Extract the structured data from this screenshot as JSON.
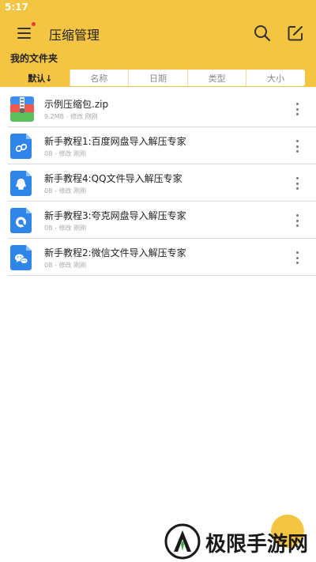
{
  "status_bar": {
    "time": "5:17"
  },
  "toolbar": {
    "title": "压缩管理",
    "menu_icon": "menu-icon",
    "search_icon": "search-icon",
    "edit_icon": "edit-icon"
  },
  "section": {
    "label": "我的文件夹"
  },
  "sort_tabs": [
    {
      "label": "默认↓",
      "active": true
    },
    {
      "label": "名称",
      "active": false
    },
    {
      "label": "日期",
      "active": false
    },
    {
      "label": "类型",
      "active": false
    },
    {
      "label": "大小",
      "active": false
    }
  ],
  "files": [
    {
      "name": "示例压缩包.zip",
      "meta": "9.2MB - 修改 刚刚",
      "icon": "zip-archive-icon"
    },
    {
      "name": "新手教程1:百度网盘导入解压专家",
      "meta": "0B - 修改 刚刚",
      "icon": "cloud-drive-doc-icon"
    },
    {
      "name": "新手教程4:QQ文件导入解压专家",
      "meta": "0B - 修改 刚刚",
      "icon": "qq-doc-icon"
    },
    {
      "name": "新手教程3:夸克网盘导入解压专家",
      "meta": "0B - 修改 刚刚",
      "icon": "quark-doc-icon"
    },
    {
      "name": "新手教程2:微信文件导入解压专家",
      "meta": "0B - 修改 刚刚",
      "icon": "wechat-doc-icon"
    }
  ],
  "watermark": {
    "text": "极限手游网"
  },
  "colors": {
    "accent": "#f4c542",
    "icon_blue": "#2f86e8",
    "divider": "#dcdcdc"
  }
}
